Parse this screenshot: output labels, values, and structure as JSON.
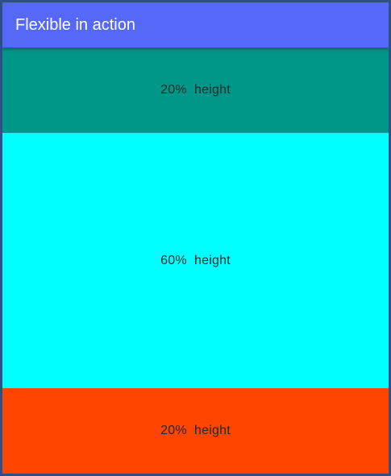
{
  "app_bar": {
    "title": "Flexible in action",
    "color": "#5668f7"
  },
  "sections": [
    {
      "label": "20%  height",
      "flex": 2,
      "color": "#009688"
    },
    {
      "label": "60%  height",
      "flex": 6,
      "color": "#00ffff"
    },
    {
      "label": "20%  height",
      "flex": 2,
      "color": "#ff4500"
    }
  ]
}
